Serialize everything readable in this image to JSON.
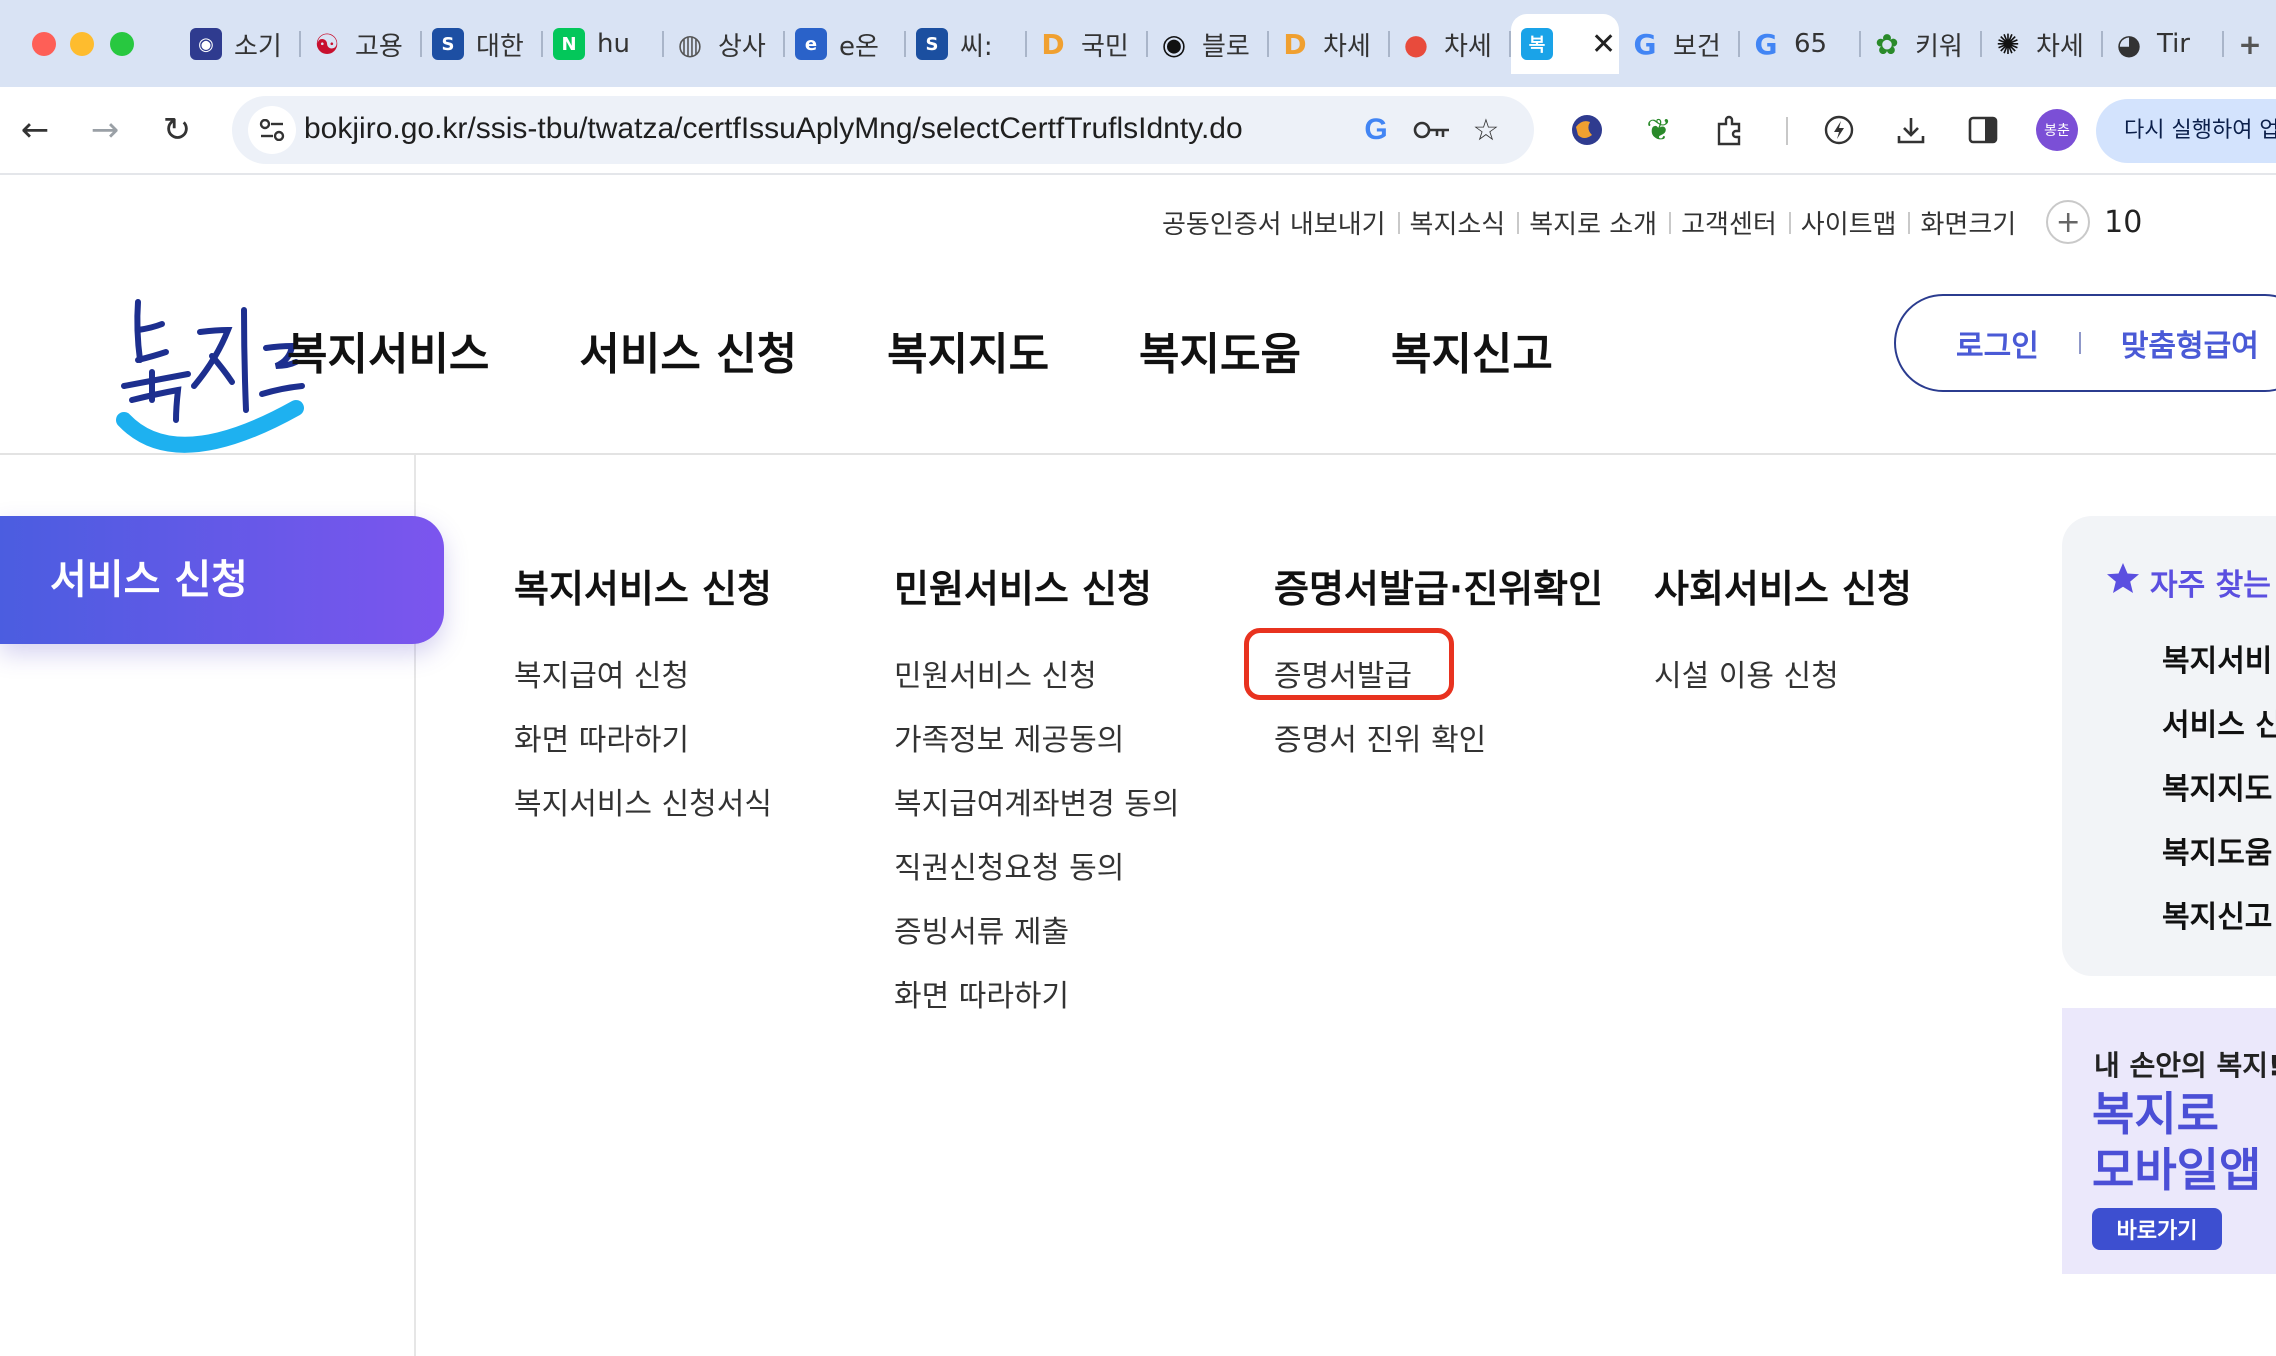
{
  "browser": {
    "tabs": [
      {
        "label": "소기",
        "icon": "globe-color-icon",
        "color": "#2f3b8f"
      },
      {
        "label": "고용",
        "icon": "korea-taegeuk-icon",
        "color": "#c8102e"
      },
      {
        "label": "대한",
        "icon": "s-logo-icon",
        "color": "#1d4fa3"
      },
      {
        "label": "hu",
        "icon": "naver-n-icon",
        "color": "#03c75a"
      },
      {
        "label": "상사",
        "icon": "globe-icon",
        "color": "#555555"
      },
      {
        "label": "e온",
        "icon": "e-logo-icon",
        "color": "#2a62c9"
      },
      {
        "label": "씨:",
        "icon": "seereal-icon",
        "color": "#1b4fa0"
      },
      {
        "label": "국민",
        "icon": "d-logo-icon",
        "color": "#f0a030"
      },
      {
        "label": "블로",
        "icon": "record-icon",
        "color": "#111111"
      },
      {
        "label": "차세",
        "icon": "d-logo-icon",
        "color": "#f0a030"
      },
      {
        "label": "차세",
        "icon": "red-circle-icon",
        "color": "#e84b3c"
      },
      {
        "label": "",
        "icon": "bokjiro-favicon-icon",
        "color": "#1aa3e8",
        "active": true
      },
      {
        "label": "보건",
        "icon": "google-g-icon",
        "color": "#4285f4"
      },
      {
        "label": "65",
        "icon": "google-g-icon",
        "color": "#4285f4"
      },
      {
        "label": "키워",
        "icon": "green-leaf-icon",
        "color": "#2a8a2a"
      },
      {
        "label": "차세",
        "icon": "chatgpt-icon",
        "color": "#111111"
      },
      {
        "label": "Tir",
        "icon": "panda-icon",
        "color": "#333333"
      },
      {
        "label": "",
        "icon": "plus-icon",
        "color": "#555555"
      }
    ],
    "url": "bokjiro.go.kr/ssis-tbu/twatza/certfIssuAplyMng/selectCertfTruflsIdnty.do",
    "profile_label": "봉춘",
    "relaunch_label": "다시 실행하여 업"
  },
  "header": {
    "utility_links": [
      "공동인증서 내보내기",
      "복지소식",
      "복지로 소개",
      "고객센터",
      "사이트맵",
      "화면크기"
    ],
    "zoom_value": "10",
    "logo_text": "복지로",
    "gnb": [
      "복지서비스",
      "서비스 신청",
      "복지지도",
      "복지도움",
      "복지신고"
    ],
    "login_label": "로그인",
    "custom_label": "맞춤형급여"
  },
  "menu": {
    "side_title": "서비스 신청",
    "columns": [
      {
        "title": "복지서비스 신청",
        "items": [
          "복지급여 신청",
          "화면 따라하기",
          "복지서비스 신청서식"
        ]
      },
      {
        "title": "민원서비스 신청",
        "items": [
          "민원서비스 신청",
          "가족정보 제공동의",
          "복지급여계좌변경 동의",
          "직권신청요청 동의",
          "증빙서류 제출",
          "화면 따라하기"
        ]
      },
      {
        "title": "증명서발급·진위확인",
        "items": [
          "증명서발급",
          "증명서 진위 확인"
        ]
      },
      {
        "title": "사회서비스 신청",
        "items": [
          "시설 이용 신청"
        ]
      }
    ]
  },
  "right_panel": {
    "fav_title": "자주 찾는",
    "fav_items": [
      "복지서비",
      "서비스 신",
      "복지지도",
      "복지도움",
      "복지신고"
    ],
    "banner_sub": "내 손안의 복지!",
    "banner_title_1": "복지로",
    "banner_title_2": "모바일앱",
    "banner_button": "바로가기"
  },
  "colors": {
    "accent": "#5b4fe0",
    "highlight": "#e8321f",
    "pill_start": "#4b5de0",
    "pill_end": "#7c55ee"
  }
}
